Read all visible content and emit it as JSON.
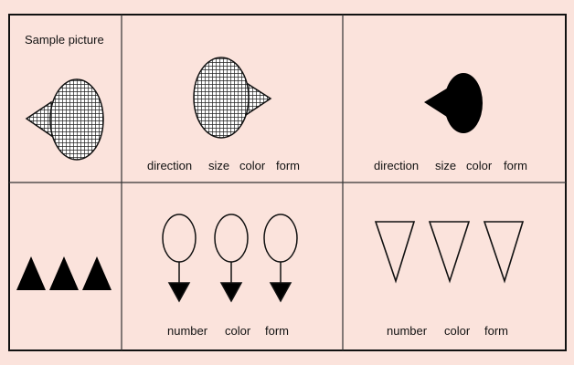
{
  "colors": {
    "background": "#fbe3dc",
    "ink": "#111111"
  },
  "cells": {
    "sample": {
      "label": "Sample picture"
    },
    "top_middle": {
      "labels": [
        "direction",
        "size",
        "color",
        "form"
      ]
    },
    "top_right": {
      "labels": [
        "direction",
        "size",
        "color",
        "form"
      ]
    },
    "bottom_middle": {
      "labels": [
        "number",
        "color",
        "form"
      ]
    },
    "bottom_right": {
      "labels": [
        "number",
        "color",
        "form"
      ]
    }
  }
}
